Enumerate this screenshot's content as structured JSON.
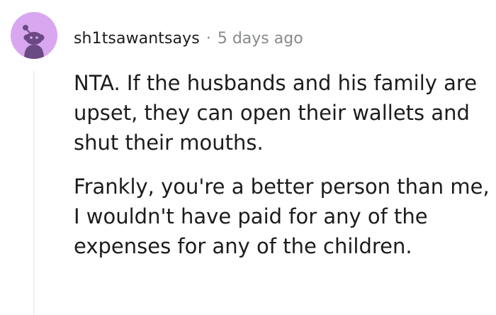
{
  "comment": {
    "username": "sh1tsawantsays",
    "separator": "·",
    "timestamp": "5 days ago",
    "paragraphs": [
      "NTA. If the husbands and his family are upset, they can open their wallets and shut their mouths.",
      "Frankly, you're a better person than me, I wouldn't have paid for any of the expenses for any of the children."
    ]
  },
  "avatar": {
    "icon": "reddit-snoo-avatar-icon",
    "background_color": "#d9a7f0",
    "figure_color": "#6b4a84"
  },
  "colors": {
    "text": "#1c1c1c",
    "meta": "#878a8c",
    "thread_line": "#edeff1"
  }
}
